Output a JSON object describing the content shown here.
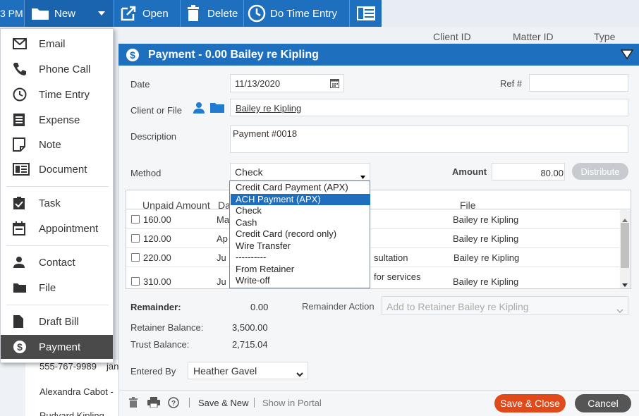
{
  "toolbar": {
    "time": "3 PM",
    "new_label": "New",
    "open_label": "Open",
    "delete_label": "Delete",
    "do_time_entry_label": "Do Time Entry"
  },
  "list_header": {
    "client_id": "Client ID",
    "matter_id": "Matter ID",
    "type": "Type"
  },
  "new_menu": {
    "items": [
      {
        "label": "Email",
        "icon": "envelope-icon"
      },
      {
        "label": "Phone Call",
        "icon": "phone-icon"
      },
      {
        "label": "Time Entry",
        "icon": "clock-icon"
      },
      {
        "label": "Expense",
        "icon": "receipt-icon"
      },
      {
        "label": "Note",
        "icon": "note-icon"
      },
      {
        "label": "Document",
        "icon": "document-icon"
      },
      {
        "label": "Task",
        "icon": "task-icon"
      },
      {
        "label": "Appointment",
        "icon": "calendar-icon"
      },
      {
        "label": "Contact",
        "icon": "person-icon"
      },
      {
        "label": "File",
        "icon": "folder-icon"
      },
      {
        "label": "Draft Bill",
        "icon": "draft-bill-icon"
      },
      {
        "label": "Payment",
        "icon": "dollar-icon"
      }
    ]
  },
  "background_list": {
    "phone": "555-767-9989",
    "phone_suffix": "jan",
    "name1": "Alexandra Cabot -",
    "name2": "Rudyard Kipling -"
  },
  "dialog": {
    "title": "Payment - 0.00 Bailey re Kipling",
    "date_label": "Date",
    "date_value": "11/13/2020",
    "ref_label": "Ref #",
    "ref_value": "",
    "client_label": "Client or File",
    "client_value": "Bailey re Kipling",
    "description_label": "Description",
    "description_value": "Payment #0018",
    "method_label": "Method",
    "method_value": "Check",
    "amount_label": "Amount",
    "amount_value": "80.00",
    "distribute_label": "Distribute",
    "method_options": [
      "Credit Card Payment (APX)",
      "ACH Payment (APX)",
      "Check",
      "Cash",
      "Credit Card (record only)",
      "Wire Transfer",
      "----------",
      "From Retainer",
      "Write-off"
    ],
    "selected_method_option": "ACH Payment (APX)",
    "grid": {
      "headers": {
        "unpaid": "Unpaid Amount",
        "date": "Da",
        "file": "File"
      },
      "rows": [
        {
          "amount": "160.00",
          "date": "Ma",
          "desc": "",
          "file": "Bailey re Kipling"
        },
        {
          "amount": "120.00",
          "date": "Ap",
          "desc": "",
          "file": "Bailey re Kipling"
        },
        {
          "amount": "220.00",
          "date": "Ju",
          "desc": "sultation",
          "file": "Bailey re Kipling"
        },
        {
          "amount": "310.00",
          "date": "Ju",
          "desc": "for services",
          "file": "Bailey re Kipling"
        }
      ]
    },
    "remainder_label": "Remainder:",
    "remainder_value": "0.00",
    "remainder_action_label": "Remainder Action",
    "remainder_action_value": "Add to Retainer Bailey re Kipling",
    "retainer_balance_label": "Retainer Balance:",
    "retainer_balance_value": "3,500.00",
    "trust_balance_label": "Trust Balance:",
    "trust_balance_value": "2,715.04",
    "entered_by_label": "Entered By",
    "entered_by_value": "Heather Gavel",
    "save_new_label": "Save & New",
    "show_in_portal_label": "Show in Portal",
    "save_close_label": "Save & Close",
    "cancel_label": "Cancel"
  },
  "colors": {
    "brand_blue": "#1f6fbf",
    "save_orange": "#e04a1a",
    "menu_active": "#4a4a4a"
  }
}
